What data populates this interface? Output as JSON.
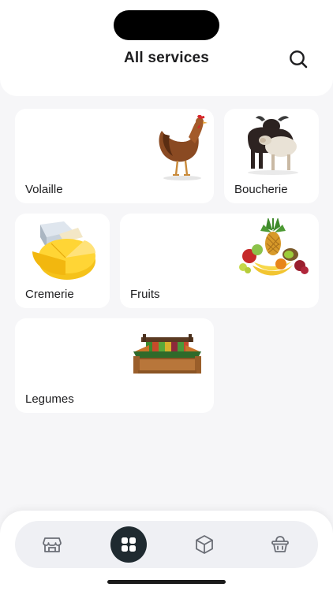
{
  "header": {
    "title": "All services",
    "search_icon": "search-icon"
  },
  "services": [
    {
      "label": "Volaille",
      "icon": "chicken-image"
    },
    {
      "label": "Boucherie",
      "icon": "bull-and-sheep-image"
    },
    {
      "label": "Cremerie",
      "icon": "cheese-image"
    },
    {
      "label": "Fruits",
      "icon": "fruit-basket-image"
    },
    {
      "label": "Legumes",
      "icon": "vegetable-stall-image"
    }
  ],
  "bottom_nav": {
    "active_index": 1,
    "items": [
      {
        "icon": "store-icon"
      },
      {
        "icon": "grid-icon"
      },
      {
        "icon": "box-icon"
      },
      {
        "icon": "basket-icon"
      }
    ]
  },
  "colors": {
    "background": "#f6f6f8",
    "card": "#ffffff",
    "nav_active": "#1f2a30",
    "nav_pill": "#eff0f4"
  }
}
